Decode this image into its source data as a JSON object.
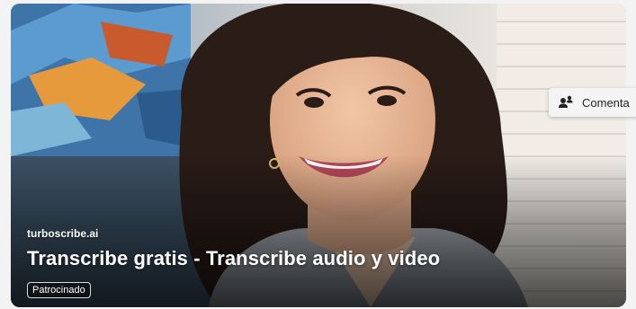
{
  "ad": {
    "source": "turboscribe.ai",
    "title": "Transcribe gratis - Transcribe audio y video",
    "badge": "Patrocinado"
  },
  "comment_button": {
    "label": "Comenta",
    "icon": "comment-people-icon"
  },
  "colors": {
    "text_on_image": "#ffffff",
    "comment_bg": "#f4f4f4",
    "comment_text": "#222222"
  }
}
